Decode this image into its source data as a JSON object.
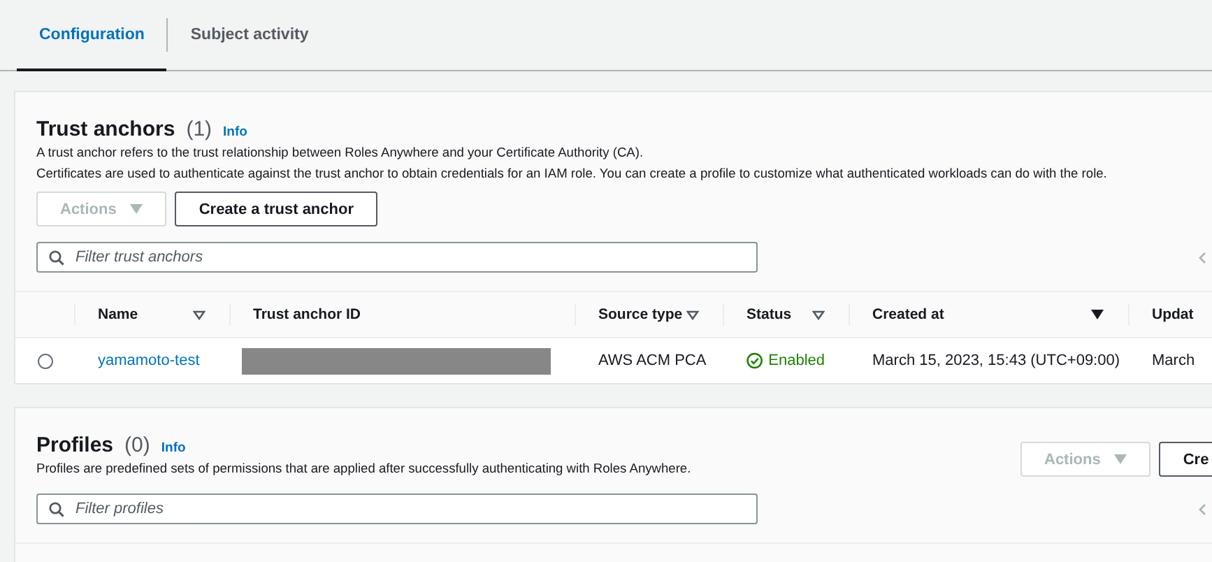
{
  "tabs": [
    {
      "label": "Configuration",
      "selected": true
    },
    {
      "label": "Subject activity",
      "selected": false
    }
  ],
  "trust_anchors": {
    "title": "Trust anchors",
    "count": "(1)",
    "info": "Info",
    "description": [
      "A trust anchor refers to the trust relationship between Roles Anywhere and your Certificate Authority (CA).",
      "Certificates are used to authenticate against the trust anchor to obtain credentials for an IAM role. You can create a profile to customize what authenticated workloads can do with the role."
    ],
    "buttons": [
      {
        "label": "Actions",
        "kind": "dropdown",
        "disabled": true
      },
      {
        "label": "Create a trust anchor",
        "kind": "normal",
        "disabled": false
      }
    ],
    "filter": {
      "placeholder": "Filter trust anchors"
    },
    "table": {
      "columns": [
        {
          "label": "Name",
          "sortable": true,
          "sorted": false
        },
        {
          "label": "Trust anchor ID",
          "sortable": false,
          "sorted": false
        },
        {
          "label": "Source type",
          "sortable": true,
          "sorted": false
        },
        {
          "label": "Status",
          "sortable": true,
          "sorted": false
        },
        {
          "label": "Created at",
          "sortable": true,
          "sorted": true
        },
        {
          "label": "Updat"
        }
      ],
      "rows": [
        {
          "selected": false,
          "name": "yamamoto-test",
          "source_type": "AWS ACM PCA",
          "status": "Enabled",
          "enabled": true,
          "created_at": "March 15, 2023, 15:43 (UTC+09:00)",
          "column_6": "March"
        }
      ]
    }
  },
  "profiles": {
    "title": "Profiles",
    "count": "(0)",
    "info": "Info",
    "description": [
      "Profiles are predefined sets of permissions that are applied after successfully authenticating with Roles Anywhere."
    ],
    "buttons": [
      {
        "label": "Actions",
        "kind": "dropdown",
        "disabled": true
      },
      {
        "label": "Cre",
        "kind": "normal",
        "disabled": false
      }
    ],
    "filter": {
      "placeholder": "Filter profiles"
    }
  }
}
